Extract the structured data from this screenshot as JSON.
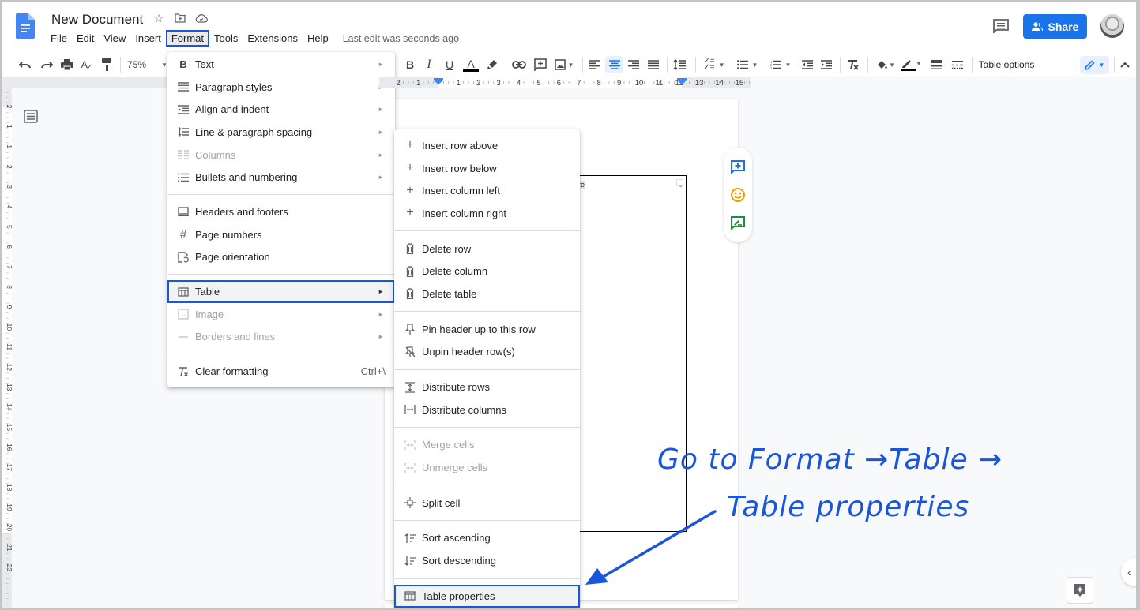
{
  "app": {
    "doc_title": "New Document",
    "last_edit": "Last edit was seconds ago",
    "share_label": "Share"
  },
  "menubar": {
    "items": [
      "File",
      "Edit",
      "View",
      "Insert",
      "Format",
      "Tools",
      "Extensions",
      "Help"
    ],
    "active": "Format"
  },
  "toolbar": {
    "zoom": "75%",
    "table_options": "Table options",
    "colors": {
      "text_color": "#000000",
      "highlight_active": "#e8f0fe",
      "accent": "#1a73e8"
    }
  },
  "ruler": {
    "left_labels": [
      "2",
      "1"
    ],
    "labels": [
      "1",
      "2",
      "3",
      "4",
      "5",
      "6",
      "7",
      "8",
      "9",
      "10",
      "11",
      "12",
      "13",
      "14",
      "15"
    ],
    "vertical_labels": [
      "2",
      "1",
      "1",
      "2",
      "3",
      "4",
      "5",
      "6",
      "7",
      "8",
      "9",
      "10",
      "11",
      "12",
      "13",
      "14",
      "15",
      "16",
      "17",
      "18",
      "19",
      "20",
      "21",
      "22"
    ]
  },
  "document": {
    "cell_text": "re"
  },
  "format_menu": {
    "items": [
      {
        "label": "Text",
        "icon": "bold-icon",
        "submenu": true,
        "disabled": false
      },
      {
        "label": "Paragraph styles",
        "icon": "paragraph-styles-icon",
        "submenu": true,
        "disabled": false
      },
      {
        "label": "Align and indent",
        "icon": "indent-icon",
        "submenu": true,
        "disabled": false
      },
      {
        "label": "Line & paragraph spacing",
        "icon": "line-spacing-icon",
        "submenu": true,
        "disabled": false
      },
      {
        "label": "Columns",
        "icon": "columns-icon",
        "submenu": true,
        "disabled": true
      },
      {
        "label": "Bullets and numbering",
        "icon": "bullets-icon",
        "submenu": true,
        "disabled": false
      },
      {
        "label": "Headers and footers",
        "icon": "header-footer-icon",
        "submenu": false,
        "disabled": false
      },
      {
        "label": "Page numbers",
        "icon": "hash-icon",
        "submenu": false,
        "disabled": false
      },
      {
        "label": "Page orientation",
        "icon": "page-orientation-icon",
        "submenu": false,
        "disabled": false
      },
      {
        "label": "Table",
        "icon": "table-icon",
        "submenu": true,
        "disabled": false,
        "highlighted": true
      },
      {
        "label": "Image",
        "icon": "image-icon",
        "submenu": true,
        "disabled": true
      },
      {
        "label": "Borders and lines",
        "icon": "borders-icon",
        "submenu": true,
        "disabled": true
      },
      {
        "label": "Clear formatting",
        "icon": "clear-format-icon",
        "shortcut": "Ctrl+\\",
        "disabled": false
      }
    ]
  },
  "table_menu": {
    "items": [
      {
        "label": "Insert row above",
        "icon": "plus-icon"
      },
      {
        "label": "Insert row below",
        "icon": "plus-icon"
      },
      {
        "label": "Insert column left",
        "icon": "plus-icon"
      },
      {
        "label": "Insert column right",
        "icon": "plus-icon"
      },
      {
        "label": "Delete row",
        "icon": "trash-icon"
      },
      {
        "label": "Delete column",
        "icon": "trash-icon"
      },
      {
        "label": "Delete table",
        "icon": "trash-icon"
      },
      {
        "label": "Pin header up to this row",
        "icon": "pin-icon"
      },
      {
        "label": "Unpin header row(s)",
        "icon": "unpin-icon"
      },
      {
        "label": "Distribute rows",
        "icon": "distribute-rows-icon"
      },
      {
        "label": "Distribute columns",
        "icon": "distribute-columns-icon"
      },
      {
        "label": "Merge cells",
        "icon": "merge-cells-icon",
        "disabled": true
      },
      {
        "label": "Unmerge cells",
        "icon": "unmerge-cells-icon",
        "disabled": true
      },
      {
        "label": "Split cell",
        "icon": "split-cell-icon"
      },
      {
        "label": "Sort ascending",
        "icon": "sort-ascending-icon"
      },
      {
        "label": "Sort descending",
        "icon": "sort-descending-icon"
      },
      {
        "label": "Table properties",
        "icon": "table-icon",
        "highlighted": true
      }
    ]
  },
  "annotation": {
    "line1": "Go to Format →Table →",
    "line2": "Table properties",
    "color": "#1a56db"
  }
}
